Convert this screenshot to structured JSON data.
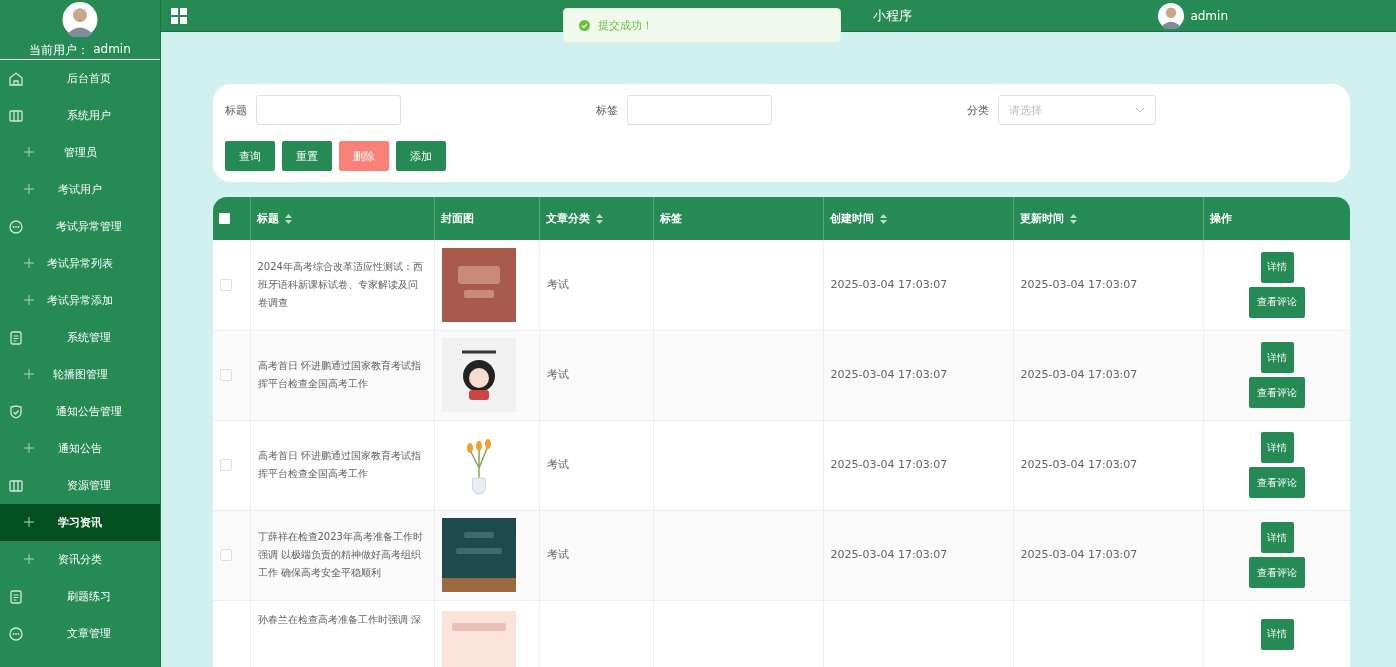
{
  "sidebar": {
    "current_user_label": "当前用户：",
    "current_user": "admin",
    "menu": [
      {
        "label": "后台首页",
        "selected": false
      },
      {
        "label": "系统用户",
        "selected": false,
        "children": [
          {
            "label": "管理员",
            "selected": false
          },
          {
            "label": "考试用户",
            "selected": false
          }
        ]
      },
      {
        "label": "考试异常管理",
        "selected": false,
        "children": [
          {
            "label": "考试异常列表",
            "selected": false
          },
          {
            "label": "考试异常添加",
            "selected": false
          }
        ]
      },
      {
        "label": "系统管理",
        "selected": false,
        "children": [
          {
            "label": "轮播图管理",
            "selected": false
          }
        ]
      },
      {
        "label": "通知公告管理",
        "selected": false,
        "children": [
          {
            "label": "通知公告",
            "selected": false
          }
        ]
      },
      {
        "label": "资源管理",
        "selected": false,
        "children": [
          {
            "label": "学习资讯",
            "selected": true
          },
          {
            "label": "资讯分类",
            "selected": false
          }
        ]
      },
      {
        "label": "刷题练习",
        "selected": false
      },
      {
        "label": "文章管理",
        "selected": false
      }
    ]
  },
  "header": {
    "title": "小程序",
    "user": "admin"
  },
  "toast": {
    "message": "提交成功！"
  },
  "search": {
    "fields": [
      {
        "label": "标题",
        "kind": "text"
      },
      {
        "label": "标签",
        "kind": "text"
      },
      {
        "label": "分类",
        "kind": "select",
        "placeholder": "请选择"
      }
    ],
    "buttons": [
      {
        "label": "查询",
        "kind": "primary"
      },
      {
        "label": "重置",
        "kind": "primary"
      },
      {
        "label": "删除",
        "kind": "danger"
      },
      {
        "label": "添加",
        "kind": "primary"
      }
    ]
  },
  "table": {
    "select_all": {
      "checked": false
    },
    "columns": [
      {
        "label": "标题",
        "sortable": true
      },
      {
        "label": "封面图",
        "sortable": false
      },
      {
        "label": "文章分类",
        "sortable": true
      },
      {
        "label": "标签",
        "sortable": false
      },
      {
        "label": "创建时间",
        "sortable": true
      },
      {
        "label": "更新时间",
        "sortable": true
      },
      {
        "label": "操作",
        "sortable": false
      }
    ],
    "rows": [
      {
        "checked": false,
        "title": "2024年高考综合改革适应性测试：西班牙语科新课标试卷、专家解读及问卷调查",
        "cover": {
          "kind": "picture"
        },
        "category": "考试",
        "created": "2025-03-04 17:03:07",
        "updated": "2025-03-04 17:03:07",
        "actions": [
          "详情",
          "查看评论"
        ]
      },
      {
        "checked": false,
        "title": "高考首日 怀进鹏通过国家教育考试指挥平台检查全国高考工作",
        "cover": {
          "kind": "picture"
        },
        "category": "考试",
        "created": "2025-03-04 17:03:07",
        "updated": "2025-03-04 17:03:07",
        "actions": [
          "详情",
          "查看评论"
        ]
      },
      {
        "checked": false,
        "title": "高考首日 怀进鹏通过国家教育考试指挥平台检查全国高考工作",
        "cover": {
          "kind": "picture"
        },
        "category": "考试",
        "created": "2025-03-04 17:03:07",
        "updated": "2025-03-04 17:03:07",
        "actions": [
          "详情",
          "查看评论"
        ]
      },
      {
        "checked": false,
        "title": "丁薛祥在检查2023年高考准备工作时强调 以极端负责的精神做好高考组织工作 确保高考安全平稳顺利",
        "cover": {
          "kind": "picture"
        },
        "category": "考试",
        "created": "2025-03-04 17:03:07",
        "updated": "2025-03-04 17:03:07",
        "actions": [
          "详情",
          "查看评论"
        ]
      },
      {
        "title": "孙春兰在检查高考准备工作时强调 深",
        "cover": {
          "kind": "picture"
        },
        "actions": [
          "详情"
        ]
      }
    ]
  }
}
